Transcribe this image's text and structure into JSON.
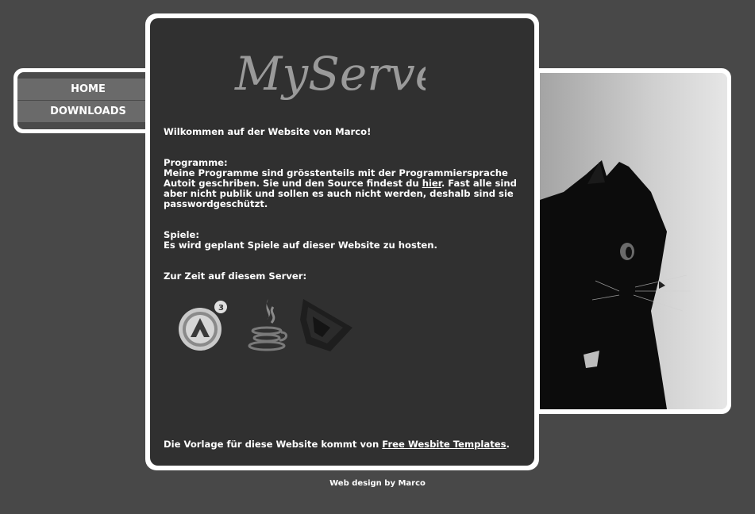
{
  "nav": {
    "items": [
      {
        "label": "HOME"
      },
      {
        "label": "DOWNLOADS"
      }
    ]
  },
  "logo": {
    "text": "MyServer"
  },
  "content": {
    "welcome": "Wilkommen auf der Website von Marco!",
    "programme_heading": "Programme:",
    "programme_text_1": "Meine Programme sind grösstenteils mit der Programmiersprache Autoit geschriben. Sie und den Source findest du ",
    "programme_link": "hier",
    "programme_text_2": ". Fast alle sind aber nicht publik und sollen es auch nicht werden, deshalb sind sie passwordgeschützt.",
    "spiele_heading": "Spiele:",
    "spiele_text": "Es wird geplant Spiele auf dieser Website zu hosten.",
    "server_heading": "Zur Zeit auf diesem Server:",
    "icons": [
      "autoit-icon",
      "java-icon",
      "unity-icon"
    ],
    "footer_text": "Die Vorlage für diese Website kommt von ",
    "footer_link": "Free Wesbite Templates",
    "footer_end": "."
  },
  "credit": "Web design by Marco",
  "colors": {
    "background": "#484848",
    "panel": "#303030",
    "frame": "#ffffff",
    "nav_item": "#6a6a6a"
  }
}
